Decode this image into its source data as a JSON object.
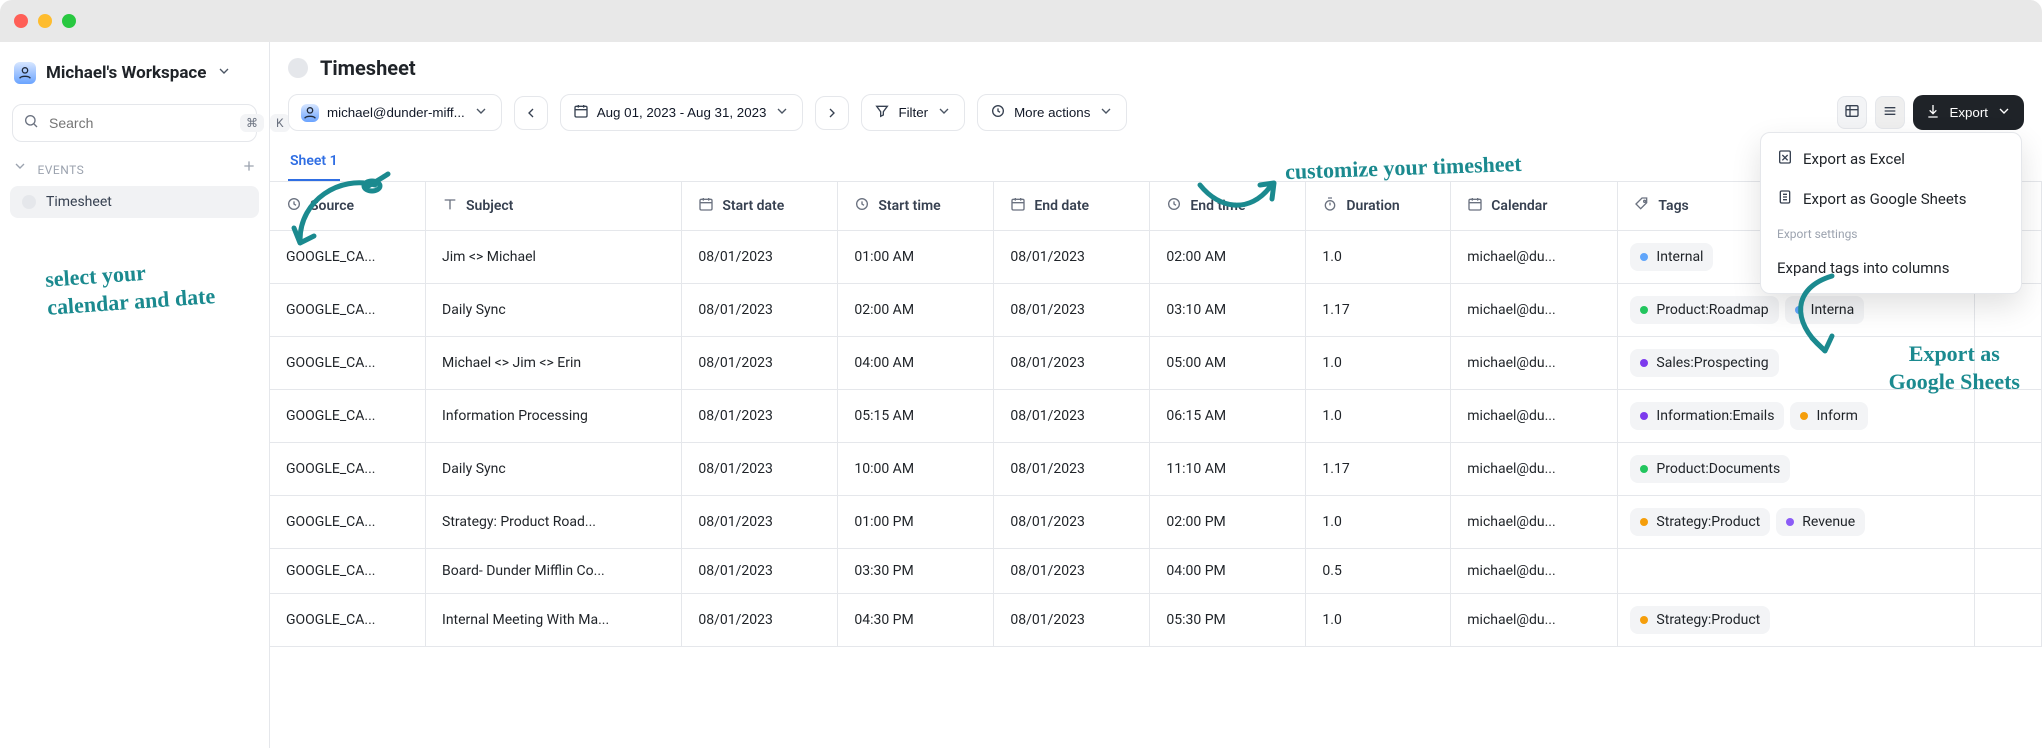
{
  "workspace": {
    "title": "Michael's Workspace"
  },
  "search": {
    "placeholder": "Search",
    "shortcut": [
      "⌘",
      "K"
    ]
  },
  "sidebar": {
    "section_label": "EVENTS",
    "items": [
      {
        "label": "Timesheet",
        "active": true
      }
    ]
  },
  "page": {
    "title": "Timesheet"
  },
  "toolbar": {
    "account_label": "michael@dunder-miff...",
    "date_range": "Aug 01, 2023 - Aug 31, 2023",
    "filter_label": "Filter",
    "more_actions_label": "More actions",
    "export_label": "Export"
  },
  "tabs": [
    {
      "label": "Sheet 1",
      "active": true
    }
  ],
  "columns": [
    {
      "key": "source",
      "label": "Source",
      "icon": "clock"
    },
    {
      "key": "subject",
      "label": "Subject",
      "icon": "type"
    },
    {
      "key": "start_date",
      "label": "Start date",
      "icon": "calendar"
    },
    {
      "key": "start_time",
      "label": "Start time",
      "icon": "clock"
    },
    {
      "key": "end_date",
      "label": "End date",
      "icon": "calendar"
    },
    {
      "key": "end_time",
      "label": "End time",
      "icon": "clock"
    },
    {
      "key": "duration",
      "label": "Duration",
      "icon": "stopwatch"
    },
    {
      "key": "calendar",
      "label": "Calendar",
      "icon": "calendar"
    },
    {
      "key": "tags",
      "label": "Tags",
      "icon": "tag"
    },
    {
      "key": "hash",
      "label": "",
      "icon": "hash"
    }
  ],
  "rows": [
    {
      "source": "GOOGLE_CA...",
      "subject": "Jim <> Michael",
      "start_date": "08/01/2023",
      "start_time": "01:00 AM",
      "end_date": "08/01/2023",
      "end_time": "02:00 AM",
      "duration": "1.0",
      "calendar": "michael@du...",
      "tags": [
        {
          "label": "Internal",
          "color": "#60a5fa"
        }
      ]
    },
    {
      "source": "GOOGLE_CA...",
      "subject": "Daily Sync",
      "start_date": "08/01/2023",
      "start_time": "02:00 AM",
      "end_date": "08/01/2023",
      "end_time": "03:10 AM",
      "duration": "1.17",
      "calendar": "michael@du...",
      "tags": [
        {
          "label": "Product:Roadmap",
          "color": "#22c55e"
        },
        {
          "label": "Interna",
          "color": "#60a5fa"
        }
      ]
    },
    {
      "source": "GOOGLE_CA...",
      "subject": "Michael <> Jim <> Erin",
      "start_date": "08/01/2023",
      "start_time": "04:00 AM",
      "end_date": "08/01/2023",
      "end_time": "05:00 AM",
      "duration": "1.0",
      "calendar": "michael@du...",
      "tags": [
        {
          "label": "Sales:Prospecting",
          "color": "#7c3aed"
        }
      ]
    },
    {
      "source": "GOOGLE_CA...",
      "subject": "Information Processing",
      "start_date": "08/01/2023",
      "start_time": "05:15 AM",
      "end_date": "08/01/2023",
      "end_time": "06:15 AM",
      "duration": "1.0",
      "calendar": "michael@du...",
      "tags": [
        {
          "label": "Information:Emails",
          "color": "#7c3aed"
        },
        {
          "label": "Inform",
          "color": "#f59e0b"
        }
      ]
    },
    {
      "source": "GOOGLE_CA...",
      "subject": "Daily Sync",
      "start_date": "08/01/2023",
      "start_time": "10:00 AM",
      "end_date": "08/01/2023",
      "end_time": "11:10 AM",
      "duration": "1.17",
      "calendar": "michael@du...",
      "tags": [
        {
          "label": "Product:Documents",
          "color": "#22c55e"
        }
      ]
    },
    {
      "source": "GOOGLE_CA...",
      "subject": "Strategy: Product Road...",
      "start_date": "08/01/2023",
      "start_time": "01:00 PM",
      "end_date": "08/01/2023",
      "end_time": "02:00 PM",
      "duration": "1.0",
      "calendar": "michael@du...",
      "tags": [
        {
          "label": "Strategy:Product",
          "color": "#f59e0b"
        },
        {
          "label": "Revenue",
          "color": "#8b5cf6"
        }
      ]
    },
    {
      "source": "GOOGLE_CA...",
      "subject": "Board- Dunder Mifflin Co...",
      "start_date": "08/01/2023",
      "start_time": "03:30 PM",
      "end_date": "08/01/2023",
      "end_time": "04:00 PM",
      "duration": "0.5",
      "calendar": "michael@du...",
      "tags": []
    },
    {
      "source": "GOOGLE_CA...",
      "subject": "Internal Meeting With Ma...",
      "start_date": "08/01/2023",
      "start_time": "04:30 PM",
      "end_date": "08/01/2023",
      "end_time": "05:30 PM",
      "duration": "1.0",
      "calendar": "michael@du...",
      "tags": [
        {
          "label": "Strategy:Product",
          "color": "#f59e0b"
        }
      ]
    }
  ],
  "export_menu": {
    "items": [
      {
        "label": "Export as Excel",
        "icon": "excel"
      },
      {
        "label": "Export as Google Sheets",
        "icon": "sheets"
      }
    ],
    "settings_label": "Export settings",
    "expand_label": "Expand tags into columns"
  },
  "annotations": {
    "select_calendar": "select your\ncalendar and date",
    "customize": "customize your timesheet",
    "export_sheets": "Export as\nGoogle Sheets"
  },
  "colors": {
    "teal": "#1b8a8f",
    "accent": "#0b62d6",
    "btn_dark": "#1f2328",
    "border": "#e5e7eb"
  }
}
